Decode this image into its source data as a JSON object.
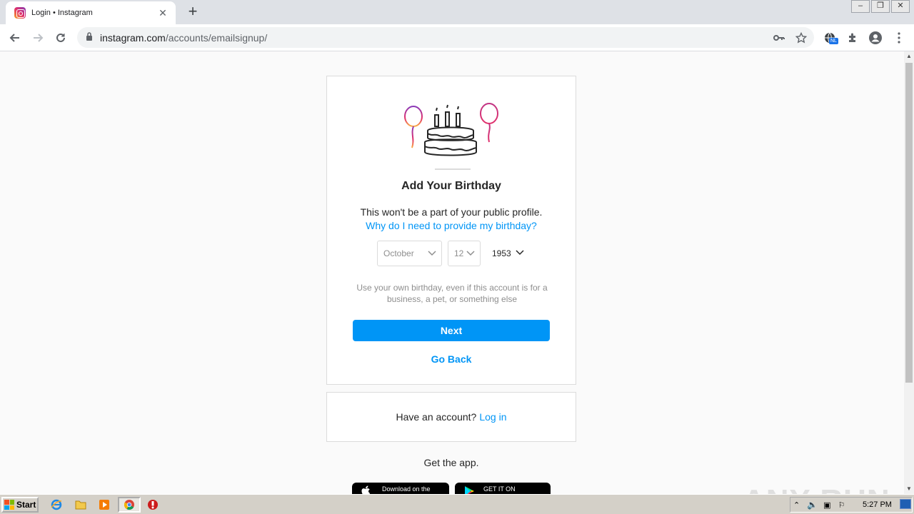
{
  "browser": {
    "tab_title": "Login • Instagram",
    "url_host": "instagram.com",
    "url_path": "/accounts/emailsignup/",
    "extension_badge": "NL"
  },
  "page": {
    "title": "Add Your Birthday",
    "subtitle": "This won't be a part of your public profile.",
    "why_link": "Why do I need to provide my birthday?",
    "month": "October",
    "day": "12",
    "year": "1953",
    "note": "Use your own birthday, even if this account is for a business, a pet, or something else",
    "next_label": "Next",
    "back_label": "Go Back",
    "have_account": "Have an account?",
    "login_label": "Log in",
    "get_app": "Get the app.",
    "apple_badge": "Download on the",
    "google_badge": "GET IT ON"
  },
  "watermark": "ANY RUN",
  "taskbar": {
    "start_label": "Start",
    "clock": "5:27 PM"
  },
  "colors": {
    "accent": "#0095f6",
    "border": "#dbdbdb"
  }
}
